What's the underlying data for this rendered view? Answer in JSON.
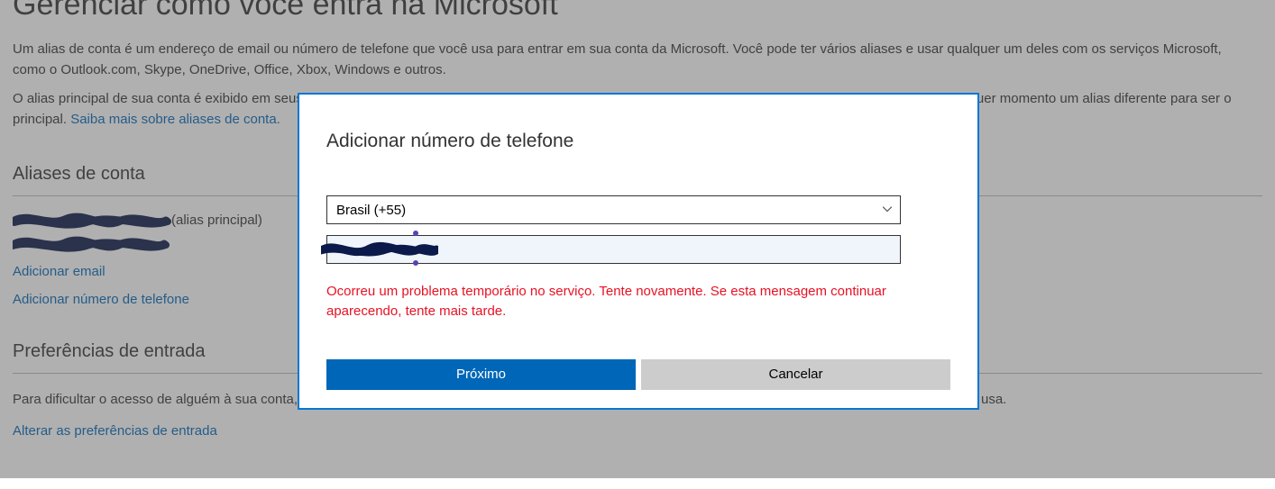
{
  "page": {
    "title": "Gerenciar como você entra na Microsoft",
    "para1": "Um alias de conta é um endereço de email ou número de telefone que você usa para entrar em sua conta da Microsoft. Você pode ter vários aliases e usar qualquer um deles com os serviços Microsoft, como o Outlook.com, Skype, OneDrive, Office, Xbox, Windows e outros.",
    "para2_prefix": "O alias principal de sua conta é exibido em seus dispositivos da Microsoft (como computador Windows, Xbox ou Windows Phone), e você pode escolher a qualquer momento um alias diferente para ser o principal. ",
    "para2_link": "Saiba mais sobre aliases de conta."
  },
  "aliases": {
    "heading": "Aliases de conta",
    "primary_suffix": " (alias principal)",
    "add_email": "Adicionar email",
    "add_phone": "Adicionar número de telefone"
  },
  "prefs": {
    "heading": "Preferências de entrada",
    "para": "Para dificultar o acesso de alguém à sua conta, desative as preferências de entrada dos endereços de email, números de telefone ou nome Skype que você não usa.",
    "change_link": "Alterar as preferências de entrada"
  },
  "modal": {
    "title": "Adicionar número de telefone",
    "country_selected": "Brasil (+55)",
    "phone_value": "",
    "error": "Ocorreu um problema temporário no serviço. Tente novamente. Se esta mensagem continuar aparecendo, tente mais tarde.",
    "next": "Próximo",
    "cancel": "Cancelar"
  }
}
